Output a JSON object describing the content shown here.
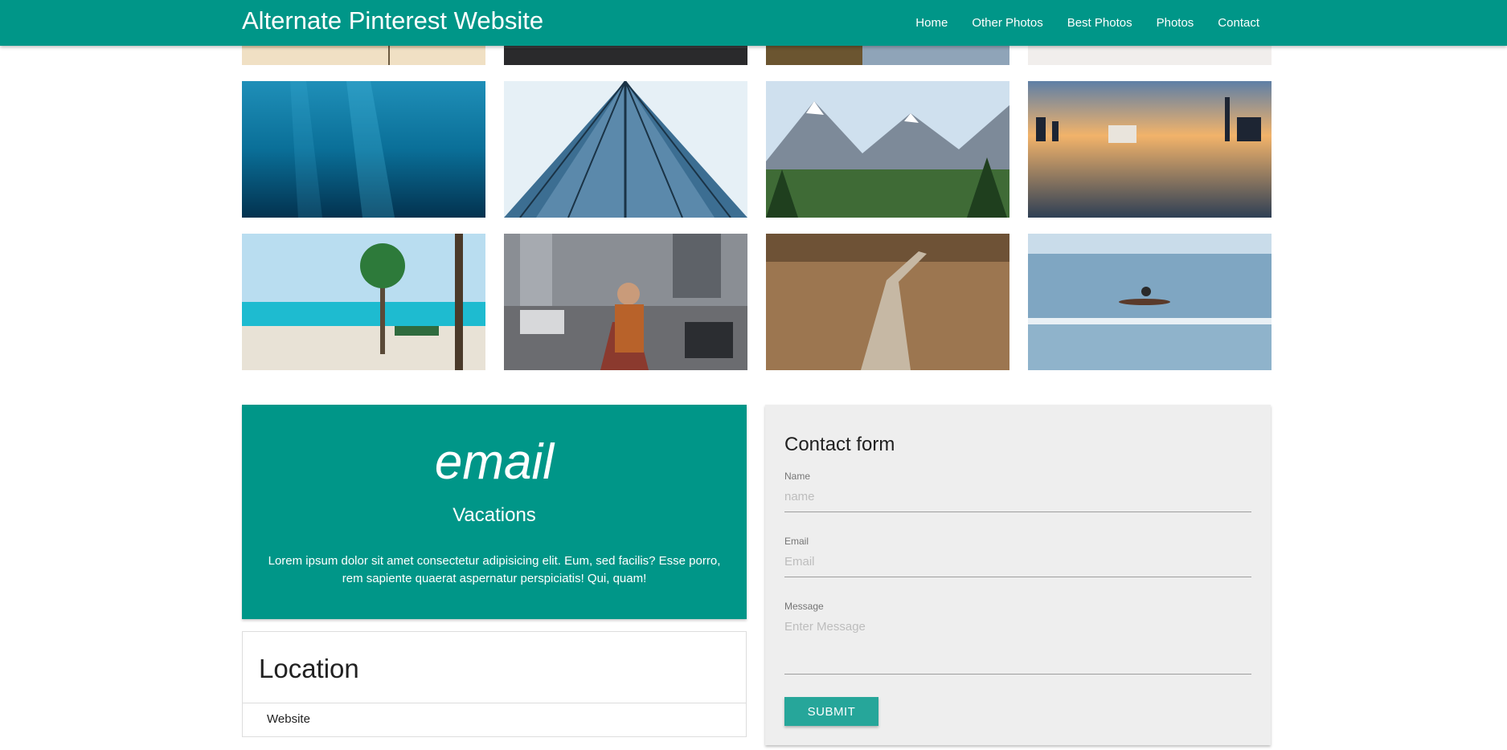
{
  "navbar": {
    "brand": "Alternate Pinterest Website",
    "links": [
      "Home",
      "Other Photos",
      "Best Photos",
      "Photos",
      "Contact"
    ]
  },
  "gallery": {
    "rows": [
      [
        "beach-sand-photo",
        "dark-road-photo",
        "river-rocks-photo",
        "snow-photo"
      ],
      [
        "underwater-photo",
        "glass-building-photo",
        "mountain-valley-photo",
        "city-sunset-boat-photo"
      ],
      [
        "palm-beach-photo",
        "city-street-woman-photo",
        "boardwalk-field-photo",
        "kayak-ocean-photo"
      ]
    ]
  },
  "email_card": {
    "heading": "email",
    "subheading": "Vacations",
    "text": "Lorem ipsum dolor sit amet consectetur adipisicing elit. Eum, sed facilis? Esse porro, rem sapiente quaerat aspernatur perspiciatis! Qui, quam!"
  },
  "location_card": {
    "title": "Location",
    "item": "Website"
  },
  "contact_form": {
    "title": "Contact form",
    "name_label": "Name",
    "name_placeholder": "name",
    "email_label": "Email",
    "email_placeholder": "Email",
    "message_label": "Message",
    "message_placeholder": "Enter Message",
    "submit_label": "SUBMIT"
  },
  "colors": {
    "primary": "#009688",
    "button": "#26a69a",
    "form_bg": "#eeeeee"
  }
}
